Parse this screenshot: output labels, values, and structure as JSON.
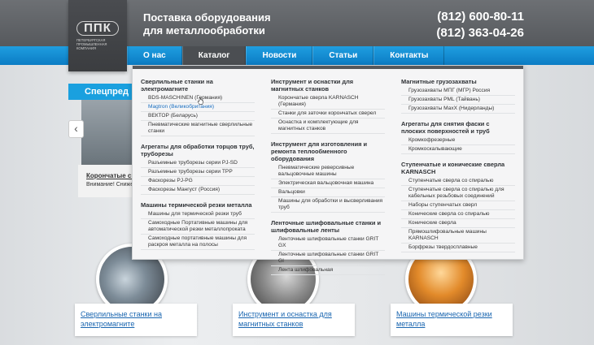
{
  "header": {
    "logo_mark": "ППК",
    "logo_text": "Петербургская промышленная компания",
    "tagline_line1": "Поставка оборудования",
    "tagline_line2": "для металлообработки",
    "phone1": "(812) 600-80-11",
    "phone2": "(812) 363-04-26"
  },
  "nav": {
    "items": [
      {
        "label": "О нас"
      },
      {
        "label": "Каталог"
      },
      {
        "label": "Новости"
      },
      {
        "label": "Статьи"
      },
      {
        "label": "Контакты"
      }
    ]
  },
  "hero": {
    "title": "Спецпред",
    "caption_title": "Корончатые све",
    "caption_text": "Внимание! Снижен",
    "arrow": "‹"
  },
  "dropdown": {
    "col1": [
      {
        "title": "Сверлильные станки на электромагните",
        "items": [
          "BDS-MASCHINEN (Германия)",
          "Magtron (Великобритания)",
          "ВЕКТОР (Беларусь)",
          "Пневматические магнитные сверлильные станки"
        ]
      },
      {
        "title": "Агрегаты для обработки торцов труб, труборезы",
        "items": [
          "Разъемные труборезы серии PJ-SD",
          "Разъемные труборезы серии TPP",
          "Фаскорезы PJ-PG",
          "Фаскорезы Мангуст (Россия)"
        ]
      },
      {
        "title": "Машины термической резки металла",
        "items": [
          "Машины для термической резки труб",
          "Самоходные Портативные машины для автоматической резки металлопроката",
          "Самоходные портативные машины для раскроя металла на полосы"
        ]
      }
    ],
    "col2": [
      {
        "title": "Инструмент и оснастки для магнитных станков",
        "items": [
          "Корончатые сверла KARNASCH (Германия)",
          "Станки для заточки корончатых сверел",
          "Оснастка и комплектующие для магнитных станков"
        ]
      },
      {
        "title": "Инструмент для изготовления и ремонта теплообменного оборудования",
        "items": [
          "Пневматические реверсивные вальцовочные машины",
          "Электрическая вальцовочная машина",
          "Вальцовки",
          "Машины для обработки и высверливания труб"
        ]
      },
      {
        "title": "Ленточные шлифовальные станки и шлифовальные ленты",
        "items": [
          "Ленточные шлифовальные станки GRIT GX",
          "Ленточные шлифовальные станки GRIT GI",
          "Лента шлифовальная"
        ]
      }
    ],
    "col3": [
      {
        "title": "Магнитные грузозахваты",
        "items": [
          "Грузозахваты МПГ (МГР) Россия",
          "Грузозахваты PML (Тайвань)",
          "Грузозахваты MaxX (Нидерланды)"
        ]
      },
      {
        "title": "Агрегаты для снятия фаски с плоских поверхностей и труб",
        "items": [
          "Кромкофрезерные",
          "Кромкоскалывающие"
        ]
      },
      {
        "title": "Ступенчатые и конические сверла KARNASCH",
        "items": [
          "Ступенчатые сверла со спиралью",
          "Ступенчатые сверла со спиралью для кабельных резьбовых соединений",
          "Наборы ступенчатых сверл",
          "Конические сверла со спиралью",
          "Конические сверла",
          "Прямошлифовальные машины KARNASCH",
          "Борфрезы твердосплавные"
        ]
      }
    ]
  },
  "cards": [
    {
      "label": "Сверлильные станки на электромагните"
    },
    {
      "label": "Инструмент и оснастка для магнитных станков"
    },
    {
      "label": "Машины термической резки металла"
    }
  ]
}
